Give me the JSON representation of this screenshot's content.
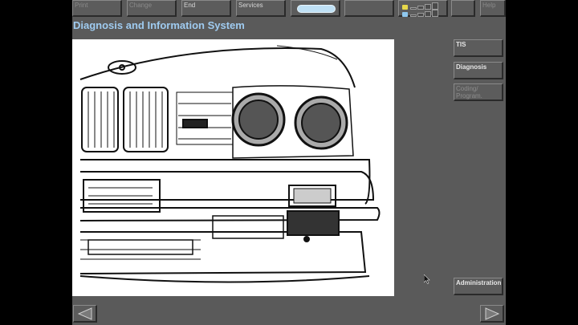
{
  "toolbar": {
    "print_label": "Print",
    "change_label": "Change",
    "end_label": "End",
    "services_label": "Services",
    "help_label": "Help"
  },
  "page_title": "Diagnosis and Information System",
  "sidebar": {
    "tis_label": "TIS",
    "diagnosis_label": "Diagnosis",
    "coding_label": "Coding/\nProgram.",
    "administration_label": "Administration"
  },
  "colors": {
    "background": "#5a5a5a",
    "title": "#9fcbf0",
    "status_pill": "#bfe0f4"
  },
  "icons": [
    "battery-indicator-icon",
    "connection-indicator-icon",
    "back-arrow-icon",
    "forward-arrow-icon",
    "mouse-cursor-icon"
  ]
}
